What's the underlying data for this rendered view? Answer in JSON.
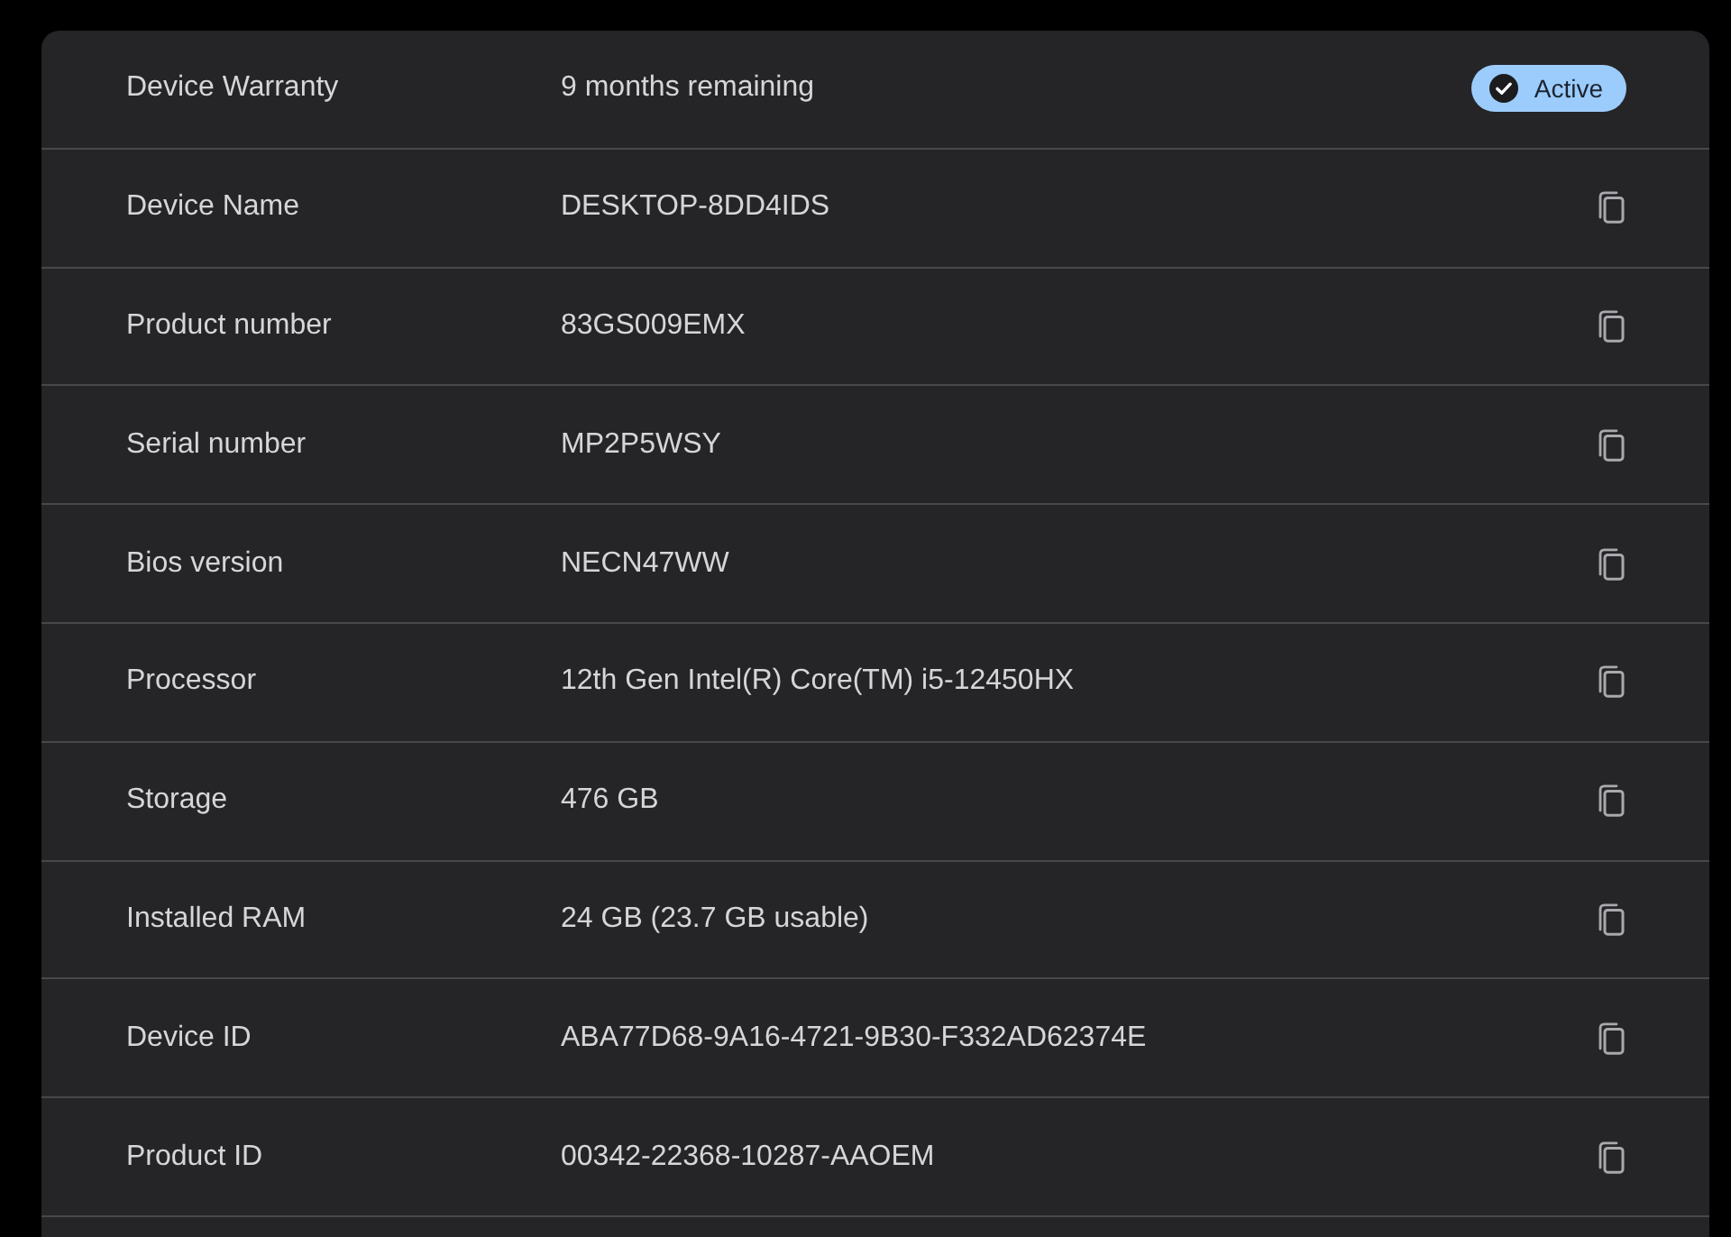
{
  "rows": [
    {
      "kind": "status",
      "label": "Device Warranty",
      "value": "9 months remaining",
      "badge": "Active"
    },
    {
      "kind": "copy",
      "label": "Device Name",
      "value": "DESKTOP-8DD4IDS"
    },
    {
      "kind": "copy",
      "label": "Product number",
      "value": "83GS009EMX"
    },
    {
      "kind": "copy",
      "label": "Serial number",
      "value": "MP2P5WSY"
    },
    {
      "kind": "copy",
      "label": "Bios version",
      "value": "NECN47WW"
    },
    {
      "kind": "copy",
      "label": "Processor",
      "value": "12th Gen Intel(R) Core(TM) i5-12450HX"
    },
    {
      "kind": "copy",
      "label": "Storage",
      "value": "476 GB"
    },
    {
      "kind": "copy",
      "label": "Installed RAM",
      "value": "24 GB (23.7 GB usable)"
    },
    {
      "kind": "copy",
      "label": "Device ID",
      "value": "ABA77D68-9A16-4721-9B30-F332AD62374E"
    },
    {
      "kind": "copy",
      "label": "Product ID",
      "value": "00342-22368-10287-AAOEM"
    }
  ]
}
